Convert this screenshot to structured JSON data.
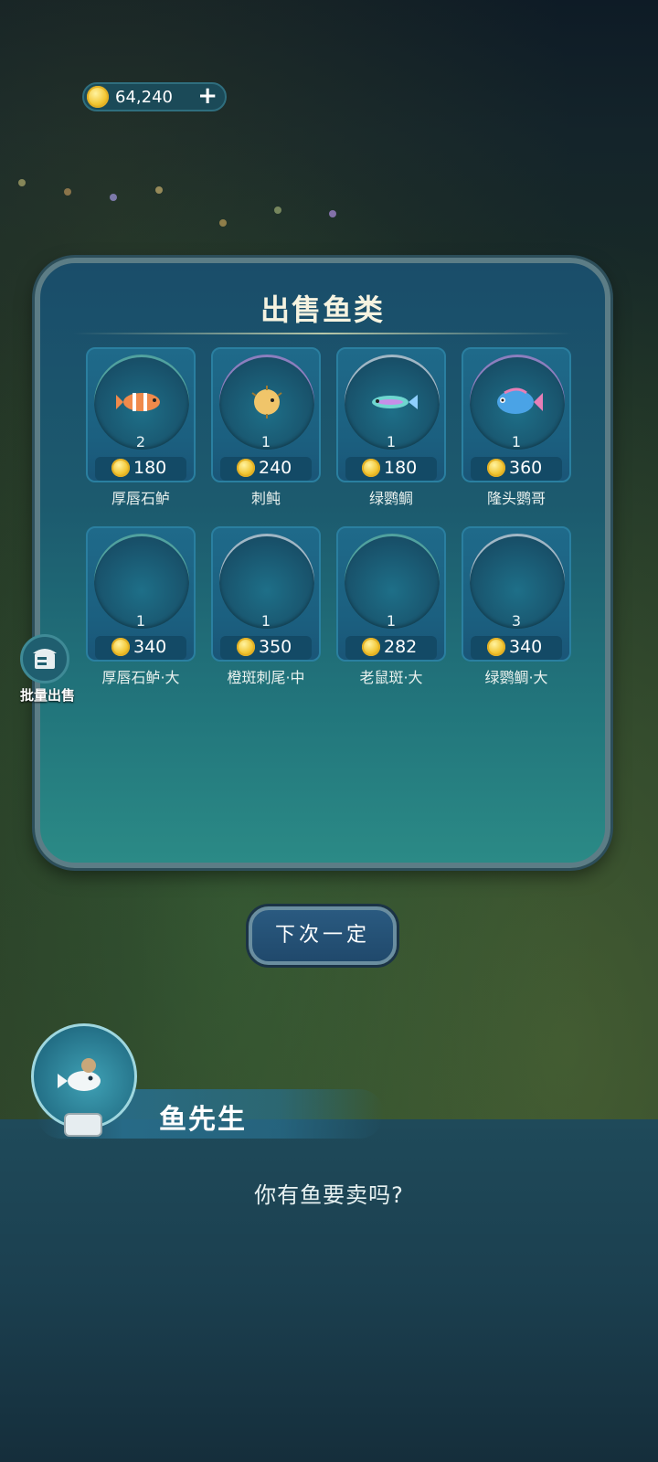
{
  "hud": {
    "coins": "64,240",
    "add_symbol": "+"
  },
  "panel": {
    "title": "出售鱼类"
  },
  "fish": [
    {
      "count": "2",
      "price": "180",
      "name": "厚唇石鲈",
      "icon": "clownfish-icon",
      "ring": "green"
    },
    {
      "count": "1",
      "price": "240",
      "name": "刺鲀",
      "icon": "pufferfish-icon",
      "ring": "purple"
    },
    {
      "count": "1",
      "price": "180",
      "name": "绿鹦鲷",
      "icon": "wrasse-icon",
      "ring": "white"
    },
    {
      "count": "1",
      "price": "360",
      "name": "隆头鹦哥",
      "icon": "parrotfish-icon",
      "ring": "purple"
    },
    {
      "count": "1",
      "price": "340",
      "name": "厚唇石鲈·大",
      "icon": "",
      "ring": "green"
    },
    {
      "count": "1",
      "price": "350",
      "name": "橙斑刺尾·中",
      "icon": "",
      "ring": "white"
    },
    {
      "count": "1",
      "price": "282",
      "name": "老鼠斑·大",
      "icon": "",
      "ring": "green"
    },
    {
      "count": "3",
      "price": "340",
      "name": "绿鹦鲷·大",
      "icon": "",
      "ring": "white"
    }
  ],
  "side": {
    "batch_sell": "批量出售"
  },
  "buttons": {
    "next_time": "下次一定"
  },
  "dialog": {
    "npc_name": "鱼先生",
    "line": "你有鱼要卖吗?"
  }
}
